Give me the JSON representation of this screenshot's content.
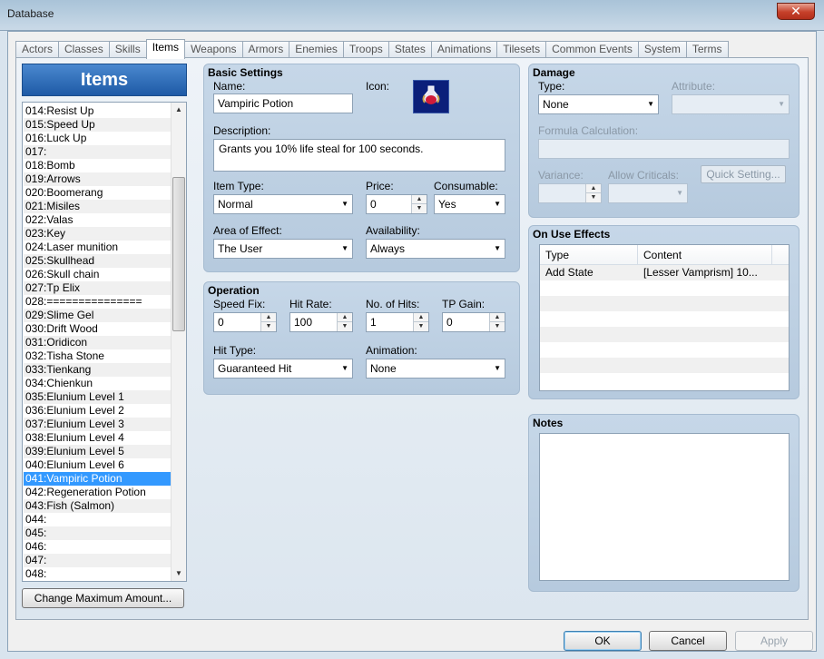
{
  "window": {
    "title": "Database",
    "close_symbol": "✕"
  },
  "tabs": [
    {
      "label": "Actors",
      "active": false
    },
    {
      "label": "Classes",
      "active": false
    },
    {
      "label": "Skills",
      "active": false
    },
    {
      "label": "Items",
      "active": true
    },
    {
      "label": "Weapons",
      "active": false
    },
    {
      "label": "Armors",
      "active": false
    },
    {
      "label": "Enemies",
      "active": false
    },
    {
      "label": "Troops",
      "active": false
    },
    {
      "label": "States",
      "active": false
    },
    {
      "label": "Animations",
      "active": false
    },
    {
      "label": "Tilesets",
      "active": false
    },
    {
      "label": "Common Events",
      "active": false
    },
    {
      "label": "System",
      "active": false
    },
    {
      "label": "Terms",
      "active": false
    }
  ],
  "list": {
    "header": "Items",
    "selected": "041:Vampiric Potion",
    "items": [
      "014:Resist Up",
      "015:Speed Up",
      "016:Luck Up",
      "017:",
      "018:Bomb",
      "019:Arrows",
      "020:Boomerang",
      "021:Misiles",
      "022:Valas",
      "023:Key",
      "024:Laser munition",
      "025:Skullhead",
      "026:Skull chain",
      "027:Tp Elix",
      "028:===============",
      "029:Slime Gel",
      "030:Drift Wood",
      "031:Oridicon",
      "032:Tisha Stone",
      "033:Tienkang",
      "034:Chienkun",
      "035:Elunium Level 1",
      "036:Elunium Level 2",
      "037:Elunium Level 3",
      "038:Elunium Level 4",
      "039:Elunium Level 5",
      "040:Elunium Level 6",
      "041:Vampiric Potion",
      "042:Regeneration Potion",
      "043:Fish (Salmon)",
      "044:",
      "045:",
      "046:",
      "047:",
      "048:"
    ],
    "change_max_button": "Change Maximum Amount..."
  },
  "basic": {
    "title": "Basic Settings",
    "name_label": "Name:",
    "name_value": "Vampiric Potion",
    "icon_label": "Icon:",
    "icon_name": "potion-icon",
    "description_label": "Description:",
    "description_value": "Grants you 10% life steal for 100 seconds.",
    "item_type_label": "Item Type:",
    "item_type_value": "Normal",
    "price_label": "Price:",
    "price_value": "0",
    "consumable_label": "Consumable:",
    "consumable_value": "Yes",
    "scope_label": "Area of Effect:",
    "scope_value": "The User",
    "availability_label": "Availability:",
    "availability_value": "Always"
  },
  "operation": {
    "title": "Operation",
    "speed_label": "Speed Fix:",
    "speed_value": "0",
    "hit_rate_label": "Hit Rate:",
    "hit_rate_value": "100",
    "hits_label": "No. of Hits:",
    "hits_value": "1",
    "tp_label": "TP Gain:",
    "tp_value": "0",
    "hit_type_label": "Hit Type:",
    "hit_type_value": "Guaranteed Hit",
    "animation_label": "Animation:",
    "animation_value": "None"
  },
  "damage": {
    "title": "Damage",
    "type_label": "Type:",
    "type_value": "None",
    "attribute_label": "Attribute:",
    "attribute_value": "",
    "formula_label": "Formula Calculation:",
    "formula_value": "",
    "variance_label": "Variance:",
    "variance_value": "",
    "criticals_label": "Allow Criticals:",
    "criticals_value": "",
    "quick_button": "Quick Setting..."
  },
  "effects": {
    "title": "On Use Effects",
    "col_type": "Type",
    "col_content": "Content",
    "rows": [
      {
        "type": "Add State",
        "content": "[Lesser Vamprism] 10..."
      },
      {
        "type": "",
        "content": ""
      },
      {
        "type": "",
        "content": ""
      },
      {
        "type": "",
        "content": ""
      },
      {
        "type": "",
        "content": ""
      },
      {
        "type": "",
        "content": ""
      },
      {
        "type": "",
        "content": ""
      },
      {
        "type": "",
        "content": ""
      }
    ]
  },
  "notes": {
    "title": "Notes",
    "value": ""
  },
  "footer": {
    "ok": "OK",
    "cancel": "Cancel",
    "apply": "Apply"
  },
  "colors": {
    "selection": "#3399ff",
    "header_blue": "#1e5aa6",
    "group_bg": "#c6d7e8"
  }
}
